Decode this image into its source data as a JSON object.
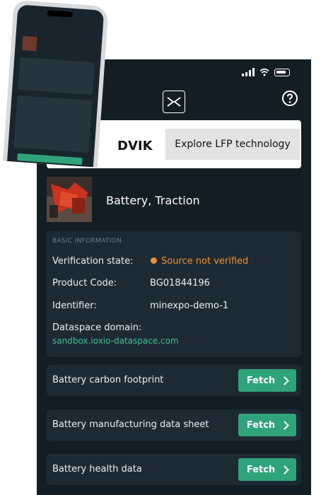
{
  "header": {
    "logo_icon": "close-x-logo-icon",
    "help_icon": "question-circle-icon"
  },
  "status_bar": {
    "icons": [
      "signal-icon",
      "wifi-icon",
      "battery-icon"
    ]
  },
  "banner": {
    "brand_text": "DVIK",
    "button_label": "Explore LFP technology"
  },
  "product": {
    "title": "Battery, Traction"
  },
  "basic_info": {
    "section_label": "BASIC INFORMATION",
    "verification_label": "Verification state:",
    "verification_value": "Source not verified",
    "product_code_label": "Product Code:",
    "product_code_value": "BG01844196",
    "identifier_label": "Identifier:",
    "identifier_value": "minexpo-demo-1",
    "dataspace_label": "Dataspace domain:",
    "dataspace_value": "sandbox.ioxio-dataspace.com"
  },
  "fetch_items": [
    {
      "label": "Battery carbon footprint",
      "button": "Fetch"
    },
    {
      "label": "Battery manufacturing data sheet",
      "button": "Fetch"
    },
    {
      "label": "Battery health data",
      "button": "Fetch"
    }
  ],
  "colors": {
    "background": "#131d24",
    "card": "#1d2a33",
    "accent": "#2fa37a",
    "warning": "#f0902b",
    "link": "#3fbf8f"
  }
}
